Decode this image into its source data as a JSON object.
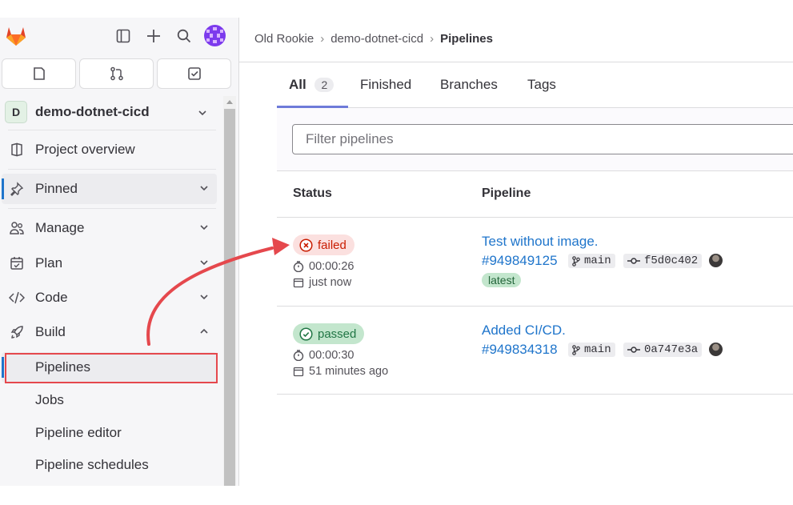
{
  "sidebar": {
    "project_initial": "D",
    "project_name": "demo-dotnet-cicd",
    "items": {
      "overview": "Project overview",
      "pinned": "Pinned",
      "manage": "Manage",
      "plan": "Plan",
      "code": "Code",
      "build": "Build"
    },
    "build_sub": {
      "pipelines": "Pipelines",
      "jobs": "Jobs",
      "pipeline_editor": "Pipeline editor",
      "pipeline_schedules": "Pipeline schedules"
    }
  },
  "breadcrumb": {
    "group": "Old Rookie",
    "project": "demo-dotnet-cicd",
    "current": "Pipelines"
  },
  "tabs": {
    "all": "All",
    "all_count": "2",
    "finished": "Finished",
    "branches": "Branches",
    "tags": "Tags"
  },
  "filter": {
    "placeholder": "Filter pipelines"
  },
  "table": {
    "col_status": "Status",
    "col_pipeline": "Pipeline",
    "rows": [
      {
        "status": "failed",
        "duration": "00:00:26",
        "finished": "just now",
        "title": "Test without image.",
        "id": "#949849125",
        "branch": "main",
        "commit": "f5d0c402",
        "badge": "latest"
      },
      {
        "status": "passed",
        "duration": "00:00:30",
        "finished": "51 minutes ago",
        "title": "Added CI/CD.",
        "id": "#949834318",
        "branch": "main",
        "commit": "0a747e3a"
      }
    ]
  },
  "colors": {
    "failed_bg": "#fbe0df",
    "failed_fg": "#c91c00",
    "passed_bg": "#c3e6cd",
    "passed_fg": "#217645",
    "link": "#1f75cb",
    "annotation": "#e5484d"
  }
}
